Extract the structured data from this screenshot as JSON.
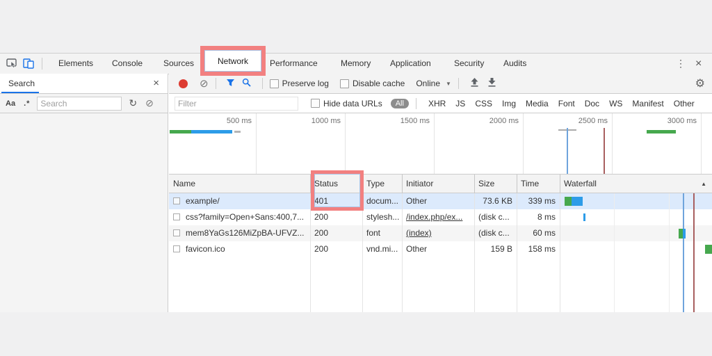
{
  "devtools": {
    "main_tabs": {
      "items": [
        "Elements",
        "Console",
        "Sources",
        "Network",
        "Performance",
        "Memory",
        "Application",
        "Security",
        "Audits"
      ],
      "active": "Network",
      "kebab_icon": "⋮",
      "close_icon": "×"
    },
    "search_panel": {
      "title": "Search",
      "close_icon": "×",
      "match_case_icon": "Aa",
      "regex_icon": ".*",
      "input_placeholder": "Search",
      "refresh_icon": "↻",
      "clear_icon": "⊘"
    },
    "network_toolbar": {
      "clear_icon": "⊘",
      "preserve_log_label": "Preserve log",
      "disable_cache_label": "Disable cache",
      "throttling_value": "Online",
      "dropdown_icon": "▼",
      "settings_icon": "⚙"
    },
    "filter_bar": {
      "input_placeholder": "Filter",
      "hide_data_urls_label": "Hide data URLs",
      "types": [
        "All",
        "XHR",
        "JS",
        "CSS",
        "Img",
        "Media",
        "Font",
        "Doc",
        "WS",
        "Manifest",
        "Other"
      ],
      "active_type": "All"
    },
    "overview": {
      "ticks": [
        "500 ms",
        "1000 ms",
        "1500 ms",
        "2000 ms",
        "2500 ms",
        "3000 ms"
      ]
    },
    "table": {
      "columns": [
        "Name",
        "Status",
        "Type",
        "Initiator",
        "Size",
        "Time",
        "Waterfall"
      ],
      "sort_indicator": "▲",
      "rows": [
        {
          "name": "example/",
          "status": "401",
          "type": "docum...",
          "initiator": "Other",
          "size": "73.6 KB",
          "time": "339 ms"
        },
        {
          "name": "css?family=Open+Sans:400,7...",
          "status": "200",
          "type": "stylesh...",
          "initiator": "/index.php/ex...",
          "size": "(disk c...",
          "time": "8 ms"
        },
        {
          "name": "mem8YaGs126MiZpBA-UFVZ...",
          "status": "200",
          "type": "font",
          "initiator": "(index)",
          "size": "(disk c...",
          "time": "60 ms"
        },
        {
          "name": "favicon.ico",
          "status": "200",
          "type": "vnd.mi...",
          "initiator": "Other",
          "size": "159 B",
          "time": "158 ms"
        }
      ]
    },
    "colors": {
      "highlight_box": "#f28080",
      "accent_blue": "#1a73e8",
      "error_red": "#cf352c",
      "muted_gray": "#9e9e9e",
      "waterfall_green": "#46a84e",
      "waterfall_blue": "#2d9ce8",
      "dom_content_loaded_line": "#6fa4dc",
      "load_event_line": "#a85f5f",
      "selected_row": "#dceafc"
    }
  }
}
